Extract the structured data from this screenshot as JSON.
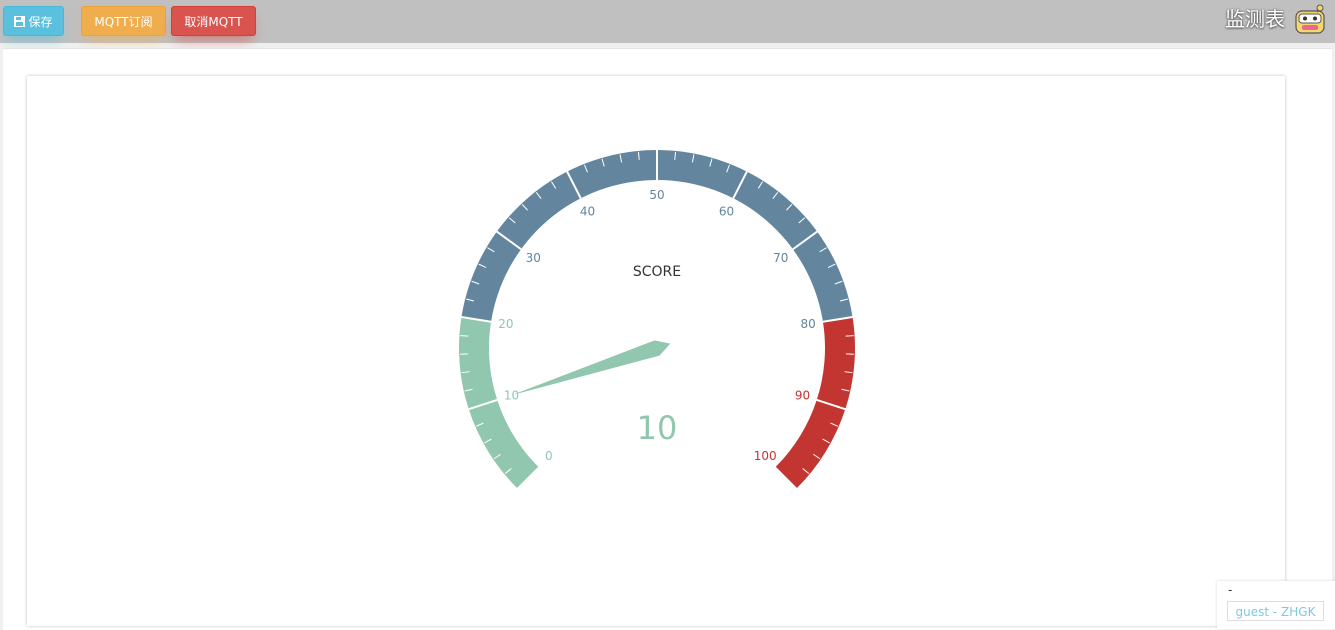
{
  "toolbar": {
    "save_label": "保存",
    "subscribe_label": "MQTT订阅",
    "cancel_label": "取消MQTT"
  },
  "header": {
    "title": "监测表"
  },
  "colors": {
    "save": "#5bc0de",
    "subscribe": "#f0ad4e",
    "cancel": "#d9534f",
    "gauge_low": "#91c7ae",
    "gauge_mid": "#63869e",
    "gauge_high": "#c23531"
  },
  "footer": {
    "dash": "-",
    "user": "guest - ZHGK"
  },
  "chart_data": {
    "type": "gauge",
    "title": "SCORE",
    "value": 10,
    "min": 0,
    "max": 100,
    "split_number": 10,
    "tick_labels": [
      "0",
      "10",
      "20",
      "30",
      "40",
      "50",
      "60",
      "70",
      "80",
      "90",
      "100"
    ],
    "bands": [
      {
        "to": 0.2,
        "color": "#91c7ae"
      },
      {
        "to": 0.8,
        "color": "#63869e"
      },
      {
        "to": 1.0,
        "color": "#c23531"
      }
    ]
  }
}
